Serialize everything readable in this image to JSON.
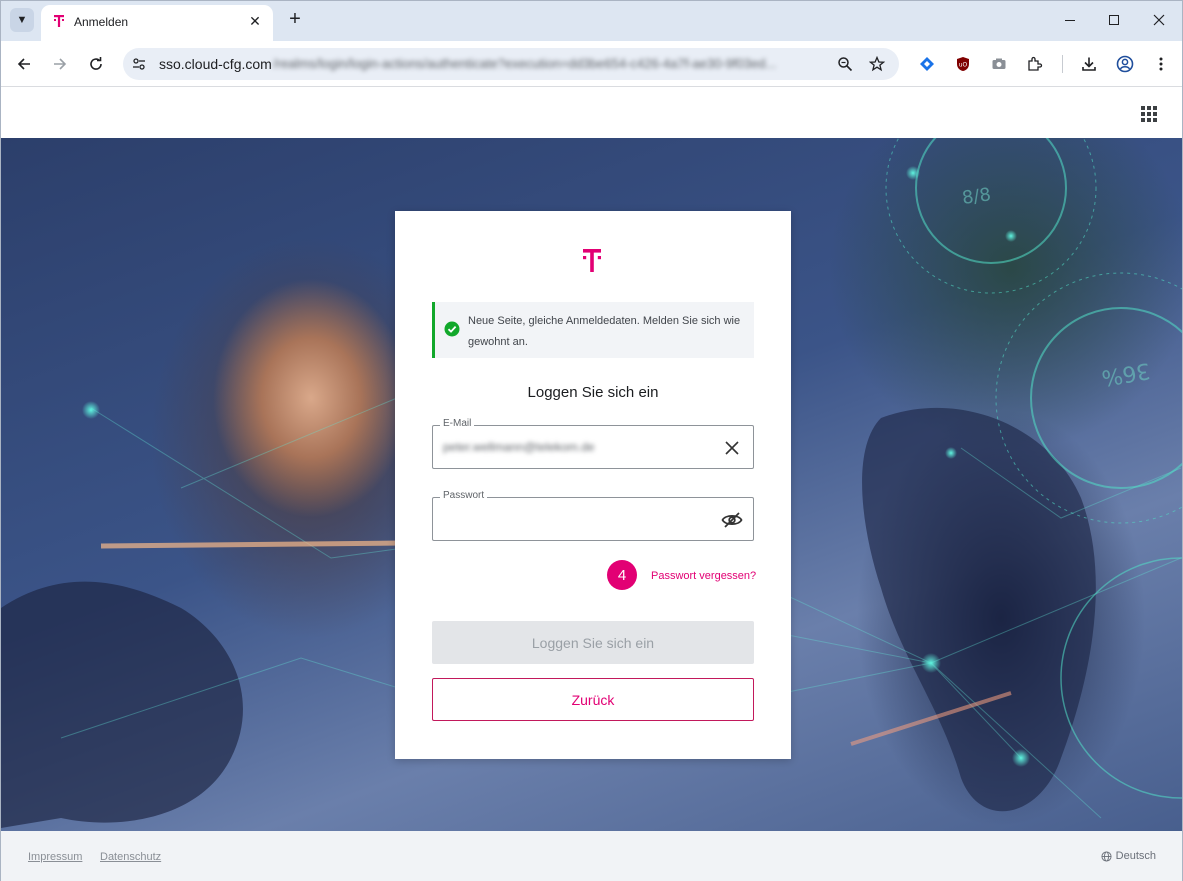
{
  "browser": {
    "tab_title": "Anmelden",
    "url_host": "sso.cloud-cfg.com",
    "url_path": "/realms/login/login-actions/authenticate?execution=dd3be654-c426-4a7f-ae30-9f03ed..."
  },
  "card": {
    "notice_text": "Neue Seite, gleiche Anmeldedaten. Melden Sie sich wie gewohnt an.",
    "title": "Loggen Sie sich ein",
    "email_label": "E-Mail",
    "email_value": "peter.wellmann@telekom.de",
    "password_label": "Passwort",
    "password_value": "",
    "step_number": "4",
    "forgot_link": "Passwort vergessen?",
    "login_button": "Loggen Sie sich ein",
    "back_button": "Zurück"
  },
  "footer": {
    "impressum": "Impressum",
    "datenschutz": "Datenschutz",
    "language": "Deutsch"
  },
  "colors": {
    "brand_magenta": "#e20074",
    "success_green": "#12a82b"
  },
  "icons": [
    "tab-search-icon",
    "telekom-logo-icon",
    "close-icon",
    "plus-icon",
    "minimize-icon",
    "maximize-icon",
    "back-arrow-icon",
    "forward-arrow-icon",
    "reload-icon",
    "site-info-icon",
    "zoom-icon",
    "star-icon",
    "extension-icon",
    "download-icon",
    "profile-icon",
    "more-menu-icon",
    "apps-grid-icon",
    "check-circle-icon",
    "clear-icon",
    "eye-off-icon",
    "globe-icon"
  ]
}
